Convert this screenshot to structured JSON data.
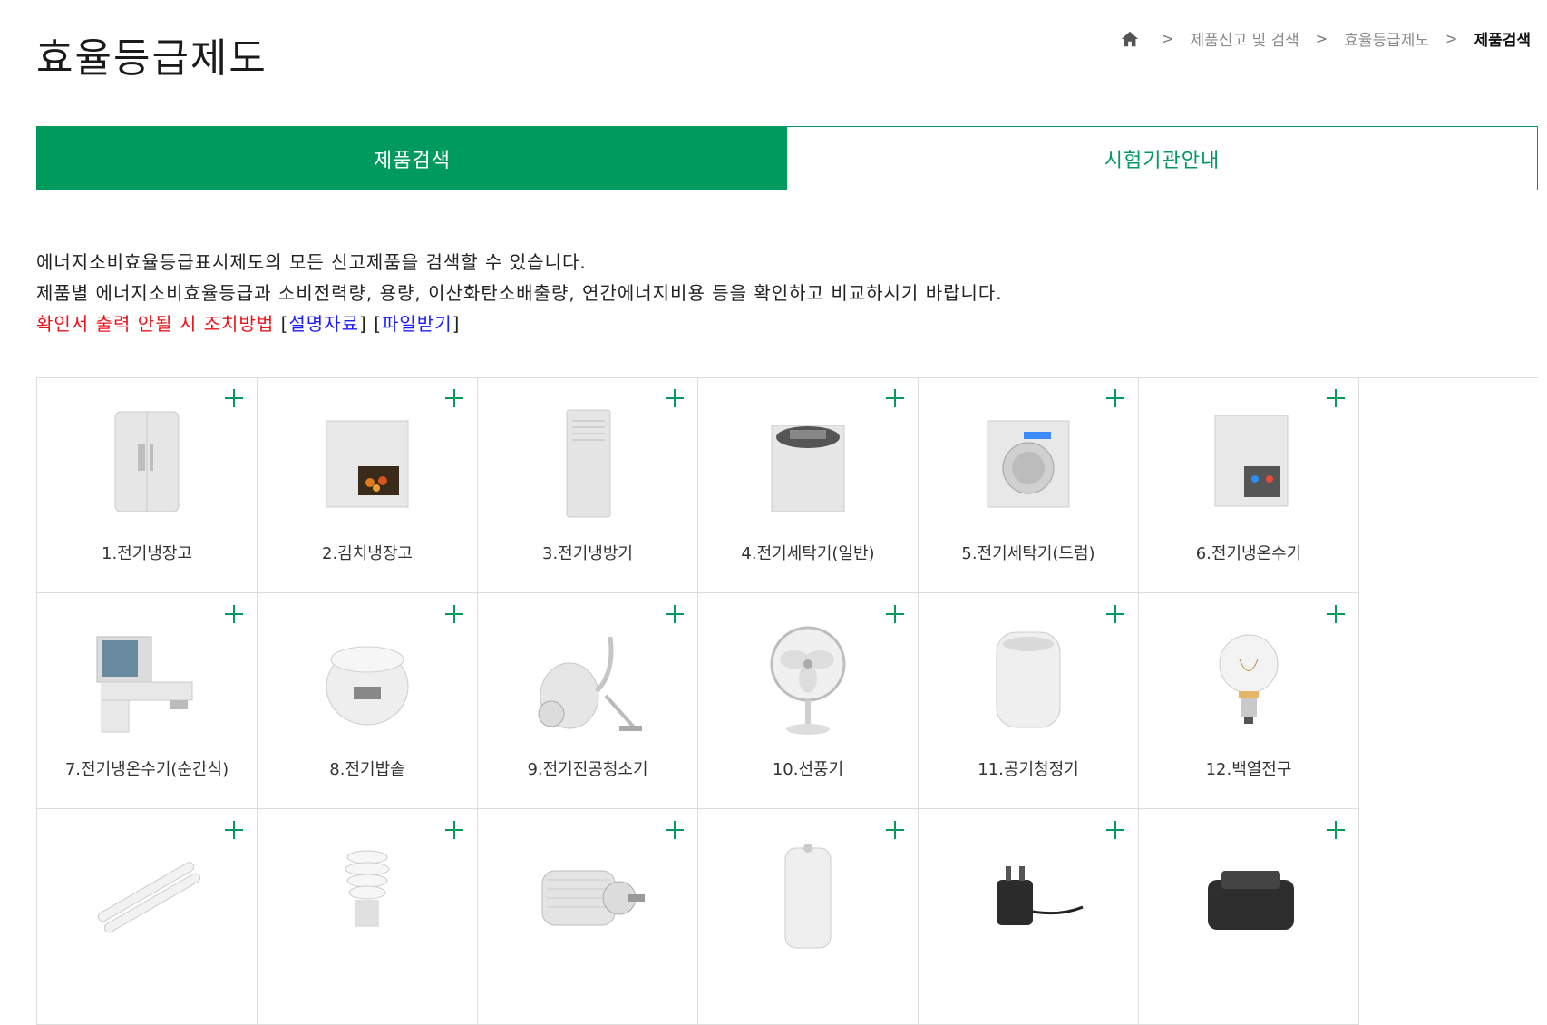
{
  "page": {
    "title": "효율등급제도"
  },
  "breadcrumb": {
    "items": [
      "제품신고 및 검색",
      "효율등급제도",
      "제품검색"
    ]
  },
  "tabs": [
    {
      "label": "제품검색",
      "active": true
    },
    {
      "label": "시험기관안내",
      "active": false
    }
  ],
  "intro": {
    "line1": "에너지소비효율등급표시제도의 모든 신고제품을 검색할 수 있습니다.",
    "line2": "제품별 에너지소비효율등급과 소비전력량, 용량, 이산화탄소배출량, 연간에너지비용 등을 확인하고 비교하시기 바랍니다.",
    "notice": "확인서 출력 안될 시 조치방법",
    "link1": "설명자료",
    "link2": "파일받기"
  },
  "colors": {
    "accent": "#009a5e",
    "notice": "#e8141c",
    "link": "#1a1aff"
  },
  "products": [
    {
      "label": "1.전기냉장고",
      "icon": "refrigerator-icon"
    },
    {
      "label": "2.김치냉장고",
      "icon": "kimchi-refrigerator-icon"
    },
    {
      "label": "3.전기냉방기",
      "icon": "air-conditioner-icon"
    },
    {
      "label": "4.전기세탁기(일반)",
      "icon": "top-loading-washer-icon"
    },
    {
      "label": "5.전기세탁기(드럼)",
      "icon": "drum-washer-icon"
    },
    {
      "label": "6.전기냉온수기",
      "icon": "water-dispenser-icon"
    },
    {
      "label": "7.전기냉온수기(순간식)",
      "icon": "instant-water-dispenser-icon"
    },
    {
      "label": "8.전기밥솥",
      "icon": "rice-cooker-icon"
    },
    {
      "label": "9.전기진공청소기",
      "icon": "vacuum-cleaner-icon"
    },
    {
      "label": "10.선풍기",
      "icon": "fan-icon"
    },
    {
      "label": "11.공기청정기",
      "icon": "air-purifier-icon"
    },
    {
      "label": "12.백열전구",
      "icon": "light-bulb-icon"
    },
    {
      "label": "",
      "icon": "fluorescent-lamp-icon"
    },
    {
      "label": "",
      "icon": "cfl-bulb-icon"
    },
    {
      "label": "",
      "icon": "electric-motor-icon"
    },
    {
      "label": "",
      "icon": "water-heater-icon"
    },
    {
      "label": "",
      "icon": "power-adapter-icon"
    },
    {
      "label": "",
      "icon": "battery-charger-icon"
    }
  ]
}
